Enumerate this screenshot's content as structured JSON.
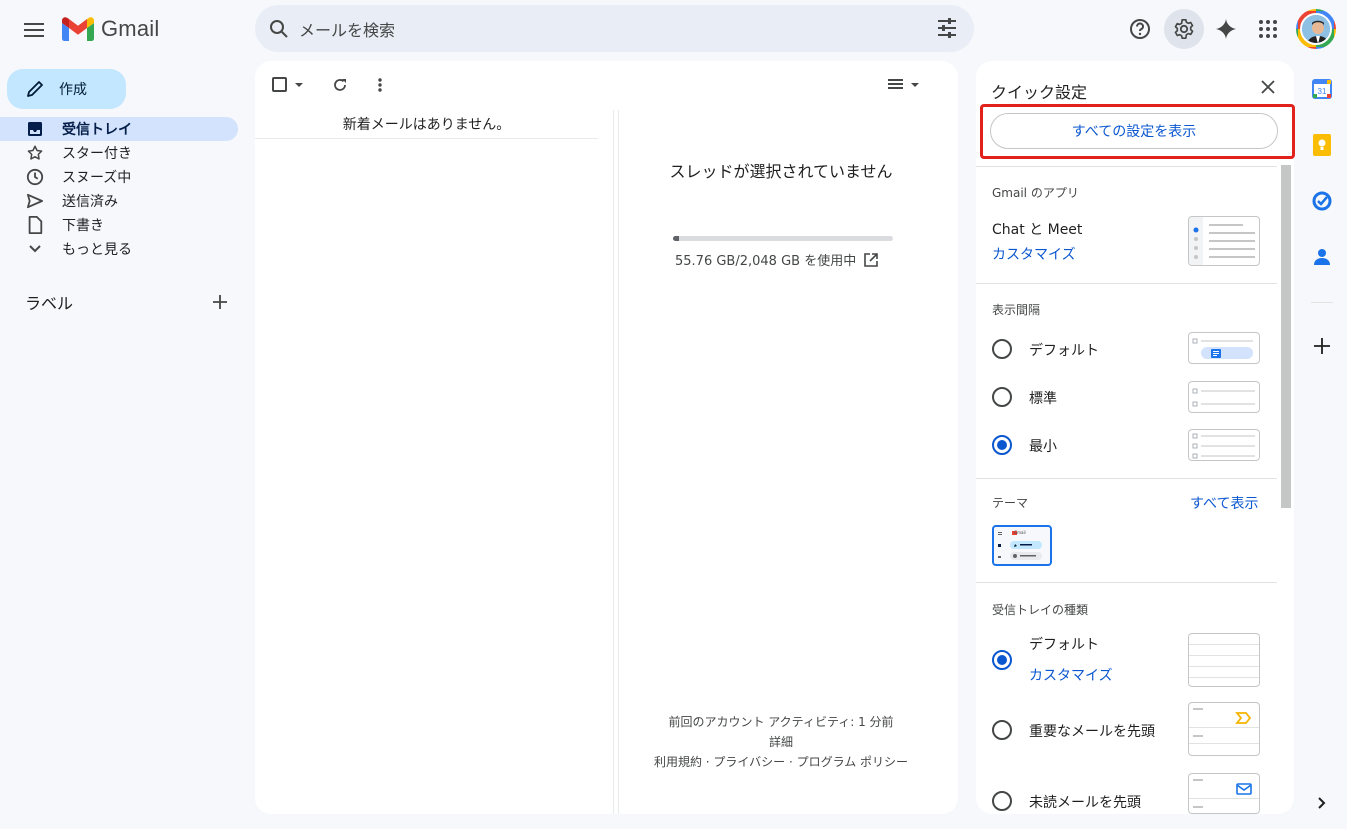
{
  "app": {
    "logo_text": "Gmail"
  },
  "search": {
    "placeholder": "メールを検索"
  },
  "sidebar": {
    "compose_label": "作成",
    "items": [
      {
        "label": "受信トレイ",
        "icon": "inbox-icon",
        "active": true
      },
      {
        "label": "スター付き",
        "icon": "star-icon"
      },
      {
        "label": "スヌーズ中",
        "icon": "clock-icon"
      },
      {
        "label": "送信済み",
        "icon": "send-icon"
      },
      {
        "label": "下書き",
        "icon": "file-icon"
      },
      {
        "label": "もっと見る",
        "icon": "chevron-down-icon"
      }
    ],
    "labels_heading": "ラベル"
  },
  "main": {
    "empty_message": "新着メールはありません。",
    "no_thread": "スレッドが選択されていません",
    "storage_text": "55.76 GB/2,048 GB を使用中",
    "storage_fraction": 0.027,
    "footer": {
      "activity": "前回のアカウント アクティビティ: 1 分前",
      "details": "詳細",
      "links": "利用規約 · プライバシー · プログラム ポリシー"
    }
  },
  "quick_settings": {
    "title": "クイック設定",
    "all_settings_button": "すべての設定を表示",
    "apps_section": "Gmail のアプリ",
    "apps_label": "Chat と Meet",
    "apps_customize": "カスタマイズ",
    "density_section": "表示間隔",
    "density_options": [
      "デフォルト",
      "標準",
      "最小"
    ],
    "density_selected": "最小",
    "theme_section": "テーマ",
    "theme_show_all": "すべて表示",
    "theme_thumb_text": "Gmail",
    "inbox_section": "受信トレイの種類",
    "inbox_options": [
      "デフォルト",
      "重要なメールを先頭",
      "未読メールを先頭"
    ],
    "inbox_customize": "カスタマイズ",
    "inbox_selected": "デフォルト"
  },
  "colors": {
    "accent": "#0b57d0",
    "compose_bg": "#c2e7ff",
    "active_nav": "#d3e3fd",
    "highlight_border": "#e2211c"
  }
}
